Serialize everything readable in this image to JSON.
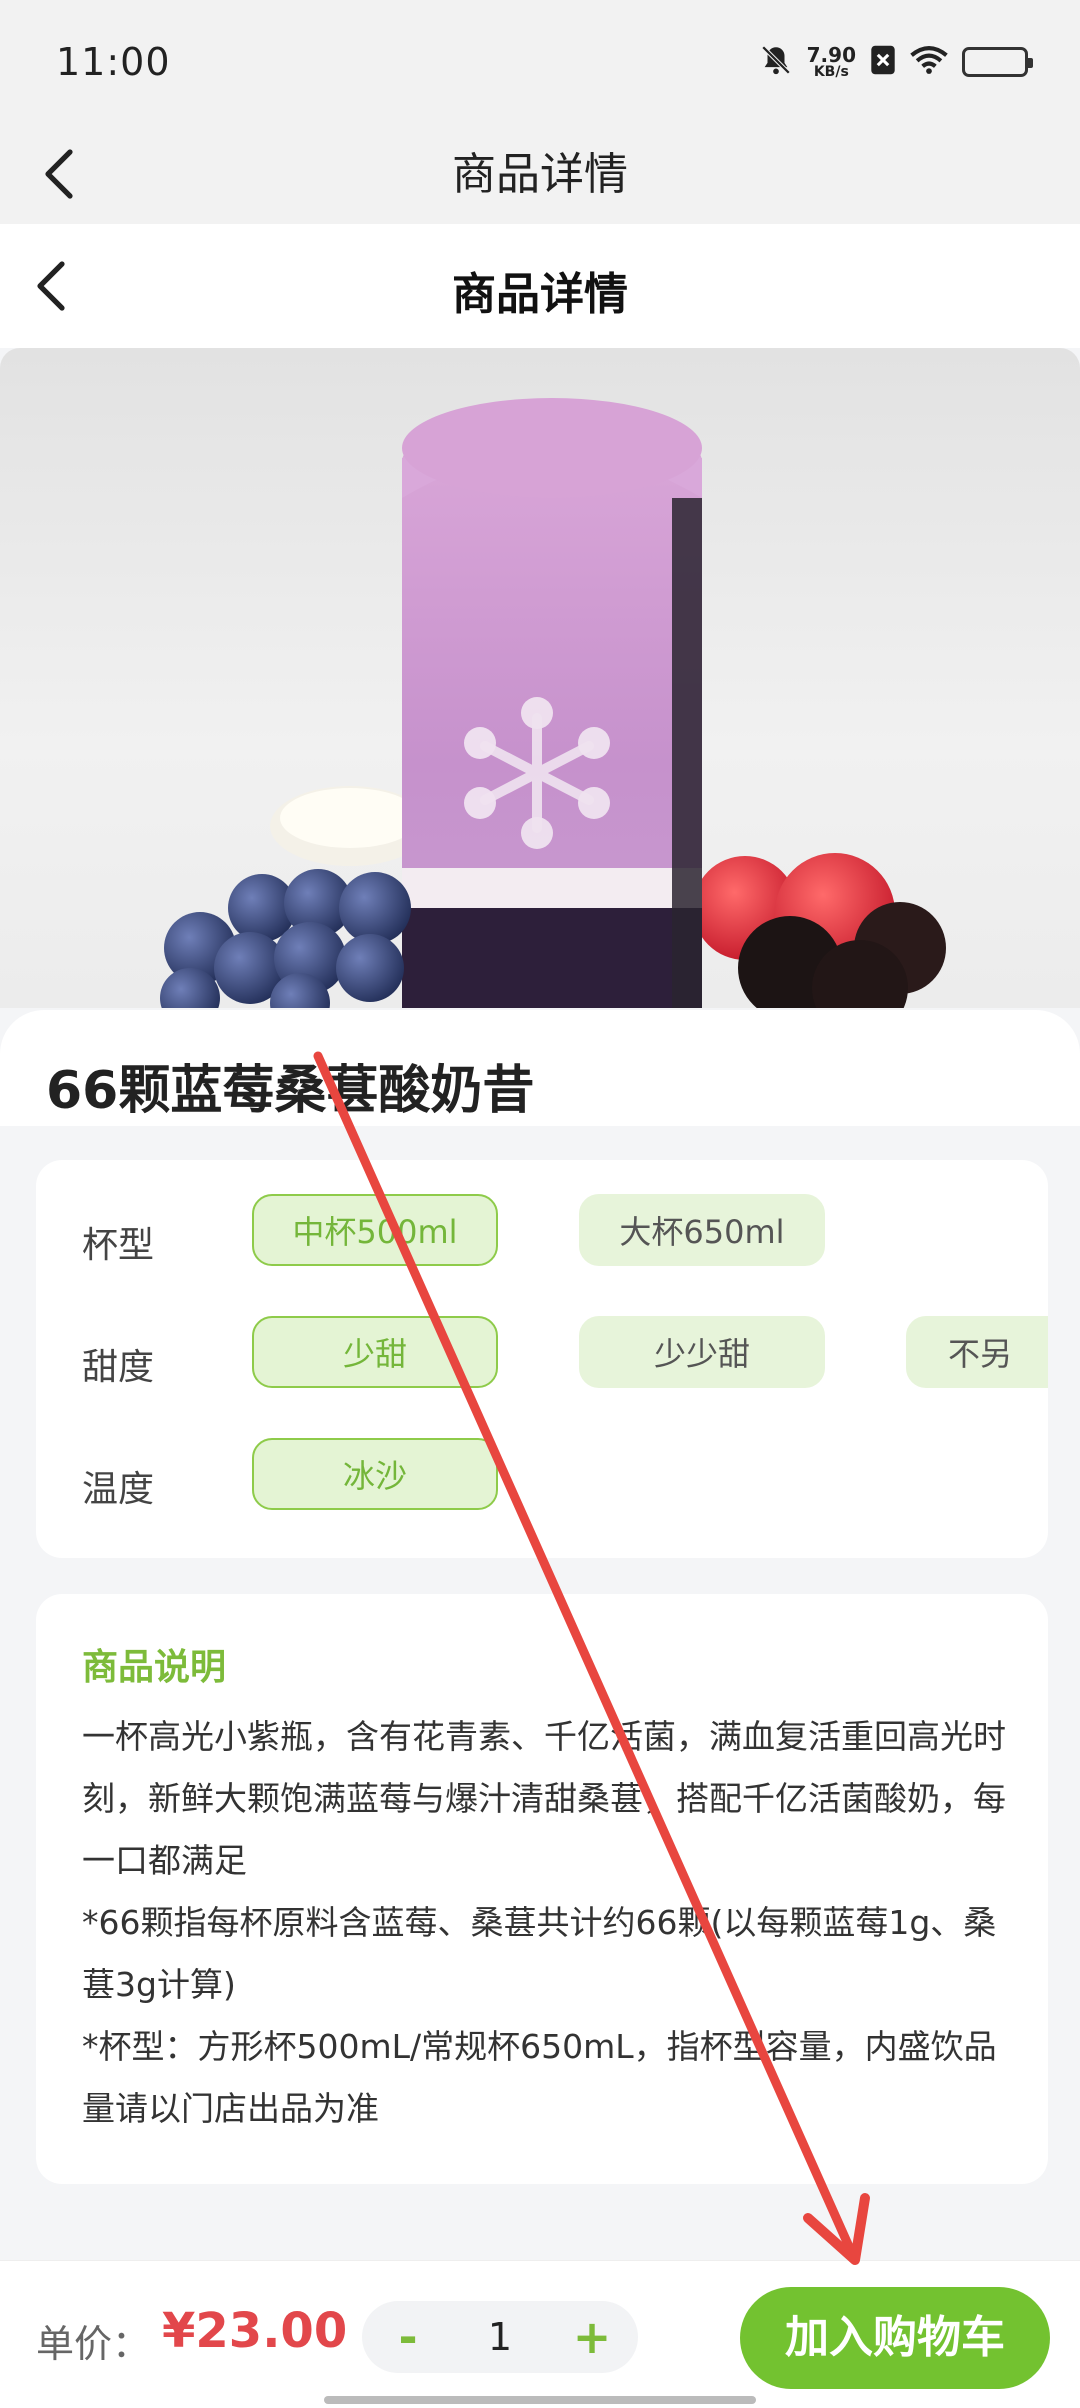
{
  "status_bar": {
    "time": "11:00",
    "network_speed_value": "7.90",
    "network_speed_unit": "KB/s",
    "icons": [
      "bell-muted-icon",
      "sim-x-icon",
      "wifi-icon",
      "battery-icon"
    ]
  },
  "outer_header": {
    "title": "商品详情",
    "back_icon": "chevron-left-icon"
  },
  "inner_header": {
    "title": "商品详情",
    "back_icon": "chevron-left-icon"
  },
  "product": {
    "name": "66颗蓝莓桑葚酸奶昔",
    "image_alt": "product-drink-image"
  },
  "options": {
    "cup": {
      "label": "杯型",
      "items": [
        {
          "label": "中杯500ml",
          "selected": true
        },
        {
          "label": "大杯650ml",
          "selected": false
        }
      ]
    },
    "sweetness": {
      "label": "甜度",
      "items": [
        {
          "label": "少甜",
          "selected": true
        },
        {
          "label": "少少甜",
          "selected": false
        },
        {
          "label": "不另",
          "selected": false
        }
      ]
    },
    "temperature": {
      "label": "温度",
      "items": [
        {
          "label": "冰沙",
          "selected": true
        }
      ]
    }
  },
  "description": {
    "title": "商品说明",
    "paragraphs": [
      "一杯高光小紫瓶，含有花青素、千亿活菌，满血复活重回高光时刻，新鲜大颗饱满蓝莓与爆汁清甜桑葚，搭配千亿活菌酸奶，每一口都满足",
      "*66颗指每杯原料含蓝莓、桑葚共计约66颗(以每颗蓝莓1g、桑葚3g计算)",
      "*杯型：方形杯500mL/常规杯650mL，指杯型容量，内盛饮品量请以门店出品为准"
    ]
  },
  "bottom_bar": {
    "price_label": "单价：",
    "price_value": "¥23.00",
    "quantity": "1",
    "minus_label": "-",
    "plus_label": "+",
    "add_to_cart_label": "加入购物车"
  },
  "colors": {
    "accent_green": "#73c230",
    "price_red": "#e2474b",
    "chip_bg": "#e4f4d4",
    "annotation_red": "#e8463f"
  }
}
